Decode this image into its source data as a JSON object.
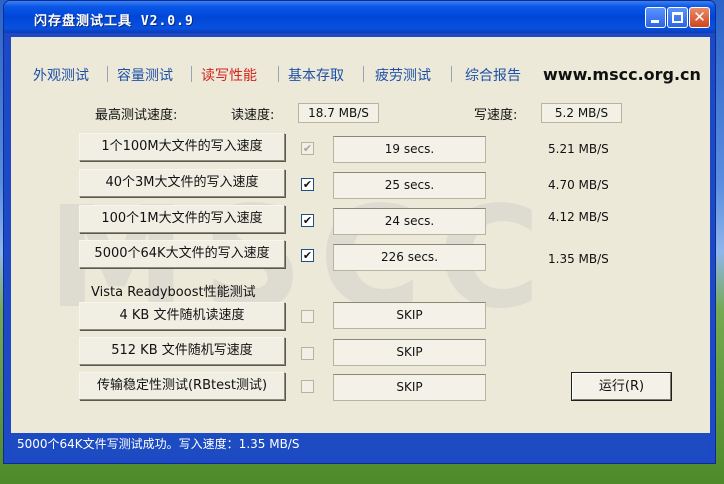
{
  "window": {
    "title": "闪存盘测试工具  V2.0.9",
    "minimize": "",
    "maximize": "",
    "close": "✕"
  },
  "tabs": [
    {
      "label": "外观测试",
      "active": false
    },
    {
      "label": "容量测试",
      "active": false
    },
    {
      "label": "读写性能",
      "active": true
    },
    {
      "label": "基本存取",
      "active": false
    },
    {
      "label": "疲劳测试",
      "active": false
    },
    {
      "label": "综合报告",
      "active": false
    }
  ],
  "site": "www.mscc.org.cn",
  "watermark": "MSCC",
  "max_speed": {
    "label": "最高测试速度:",
    "read_label": "读速度:",
    "read_value": "18.7 MB/S",
    "write_label": "写速度:",
    "write_value": "5.2 MB/S"
  },
  "write_tests": [
    {
      "label": "1个100M大文件的写入速度",
      "checked": true,
      "enabled": false,
      "result": "19 secs.",
      "rate": "5.21 MB/S"
    },
    {
      "label": "40个3M大文件的写入速度",
      "checked": true,
      "enabled": true,
      "result": "25 secs.",
      "rate": "4.70 MB/S"
    },
    {
      "label": "100个1M大文件的写入速度",
      "checked": true,
      "enabled": true,
      "result": "24 secs.",
      "rate": "4.12 MB/S"
    },
    {
      "label": "5000个64K大文件的写入速度",
      "checked": true,
      "enabled": true,
      "result": "226 secs.",
      "rate": "1.35 MB/S"
    }
  ],
  "vista_section": "Vista Readyboost性能测试",
  "vista_tests": [
    {
      "label": "4 KB  文件随机读速度",
      "checked": false,
      "enabled": false,
      "result": "SKIP"
    },
    {
      "label": "512 KB  文件随机写速度",
      "checked": false,
      "enabled": false,
      "result": "SKIP"
    },
    {
      "label": "传输稳定性测试(RBtest测试)",
      "checked": false,
      "enabled": false,
      "result": "SKIP"
    }
  ],
  "run_button": "运行(R)",
  "checkmark": "✔",
  "status": "5000个64K文件写测试成功。写入速度：1.35 MB/S"
}
